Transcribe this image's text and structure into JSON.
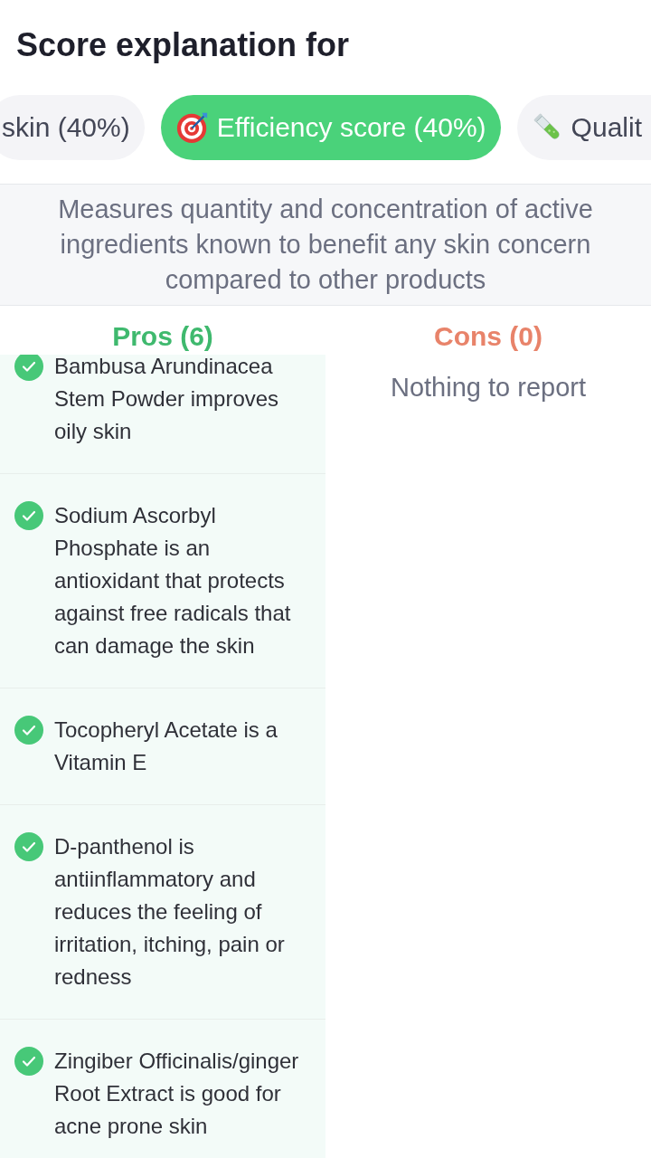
{
  "title": "Score explanation for",
  "tabs": [
    {
      "label": "skin (40%)",
      "selected": false
    },
    {
      "label": "Efficiency score (40%)",
      "selected": true
    },
    {
      "label": "Qualit",
      "selected": false
    }
  ],
  "description": "Measures quantity and concentration of active ingredients known to benefit any skin concern compared to other products",
  "pros": {
    "heading": "Pros (6)",
    "items": [
      {
        "text": "Bambusa Arundinacea Stem Powder improves oily skin"
      },
      {
        "text": "Sodium Ascorbyl Phosphate is an antioxidant that protects against free radicals that can damage the skin"
      },
      {
        "text": "Tocopheryl Acetate is a Vitamin E"
      },
      {
        "text": "D-panthenol is antiinflammatory and reduces the feeling of irritation, itching, pain or redness"
      },
      {
        "text": "Zingiber Officinalis/ginger Root Extract is good for acne prone skin"
      }
    ]
  },
  "cons": {
    "heading": "Cons (0)",
    "empty_text": "Nothing to report"
  }
}
